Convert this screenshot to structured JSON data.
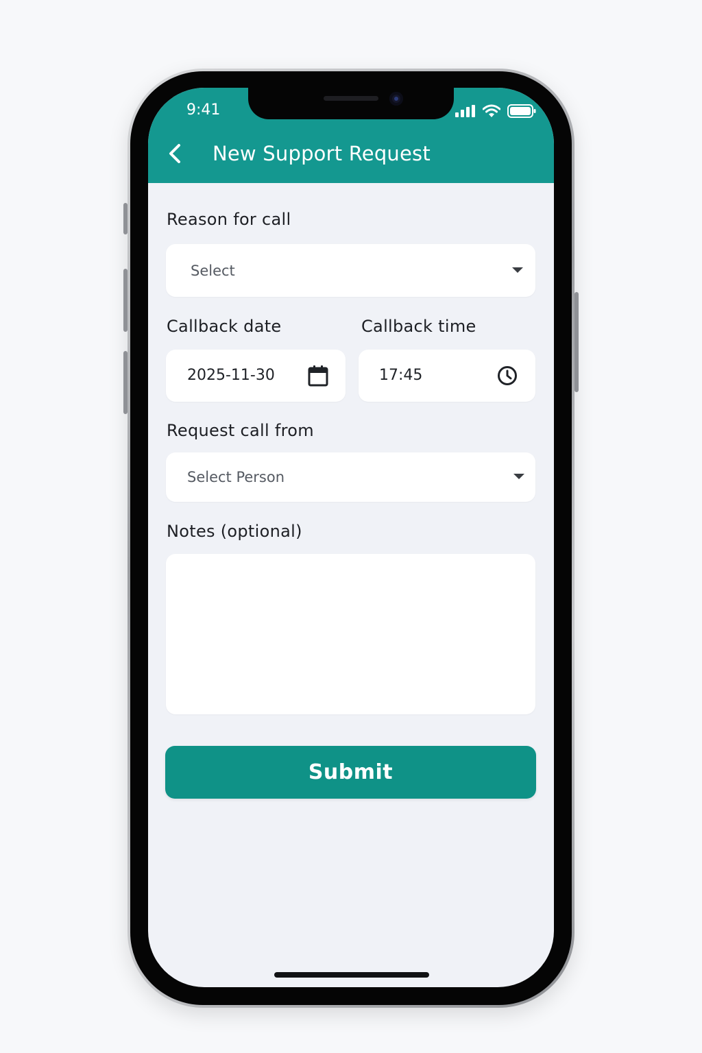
{
  "status_bar": {
    "time": "9:41"
  },
  "header": {
    "title": "New Support Request",
    "back_icon": "chevron-left-icon"
  },
  "form": {
    "reason": {
      "label": "Reason for call",
      "placeholder": "Select"
    },
    "callback_date": {
      "label": "Callback date",
      "value": "2025-11-30",
      "icon": "calendar-icon"
    },
    "callback_time": {
      "label": "Callback time",
      "value": "17:45",
      "icon": "clock-icon"
    },
    "request_from": {
      "label": "Request call from",
      "placeholder": "Select Person"
    },
    "notes": {
      "label": "Notes (optional)",
      "value": ""
    },
    "submit_label": "Submit"
  },
  "colors": {
    "accent": "#149890",
    "button": "#0f9287",
    "background": "#f0f2f7",
    "field": "#ffffff"
  }
}
